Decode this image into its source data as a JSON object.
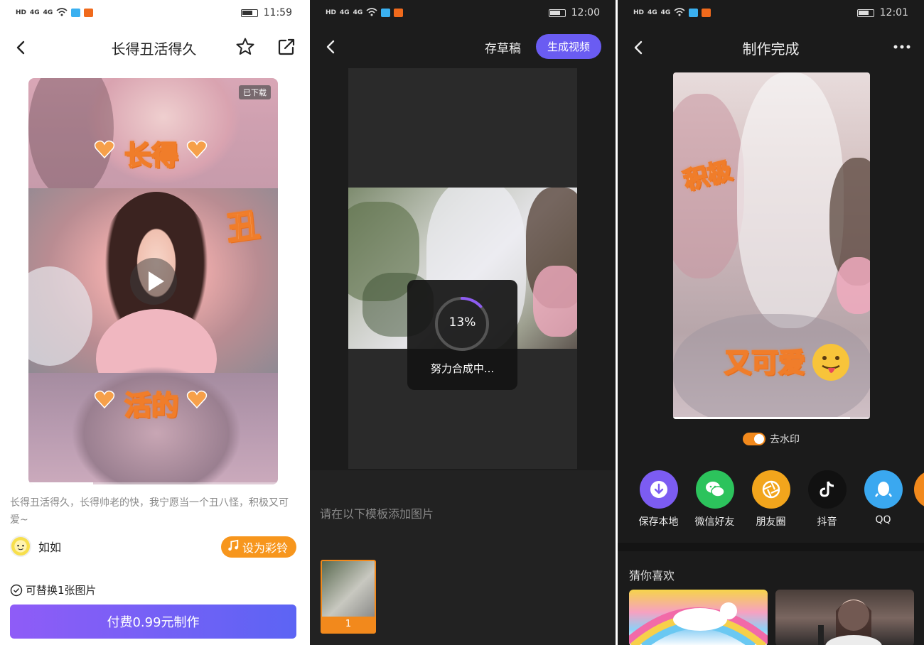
{
  "screen1": {
    "status": {
      "time": "11:59",
      "network1": "4G",
      "network2": "4G",
      "hd": "HD"
    },
    "header": {
      "title": "长得丑活得久"
    },
    "video": {
      "badge": "已下载",
      "overlay_top": "长得",
      "overlay_mid": "丑",
      "overlay_bottom": "活的",
      "progress": 0.26
    },
    "description": "长得丑活得久，长得帅老的快，我宁愿当一个丑八怪，积极又可爱~",
    "author": {
      "name": "如如"
    },
    "ringtone_button": "设为彩铃",
    "replace_note": "可替换1张图片",
    "pay_button": "付费0.99元制作"
  },
  "screen2": {
    "status": {
      "time": "12:00",
      "network1": "4G",
      "network2": "4G",
      "hd": "HD"
    },
    "header": {
      "draft_button": "存草稿",
      "generate_button": "生成视频"
    },
    "loading": {
      "percent": "13%",
      "progress": 0.13,
      "text": "努力合成中..."
    },
    "hint": "请在以下模板添加图片",
    "thumbnails": [
      {
        "label": "1"
      }
    ]
  },
  "screen3": {
    "status": {
      "time": "12:01",
      "network1": "4G",
      "network2": "4G",
      "hd": "HD"
    },
    "header": {
      "title": "制作完成"
    },
    "video": {
      "overlay_top": "积极",
      "overlay_bottom": "又可爱"
    },
    "watermark": {
      "label": "去水印",
      "enabled": true
    },
    "share_targets": [
      {
        "label": "保存本地",
        "icon": "download-icon",
        "color": "#7c5cf2"
      },
      {
        "label": "微信好友",
        "icon": "wechat-icon",
        "color": "#2cc35c"
      },
      {
        "label": "朋友圈",
        "icon": "moments-icon",
        "color": "#f2a51c"
      },
      {
        "label": "抖音",
        "icon": "douyin-icon",
        "color": "#111111"
      },
      {
        "label": "QQ",
        "icon": "qq-icon",
        "color": "#3aa8f0"
      }
    ],
    "recommend_title": "猜你喜欢"
  },
  "colors": {
    "accent_purple": "#6a5cf2",
    "accent_orange": "#f2891c"
  }
}
